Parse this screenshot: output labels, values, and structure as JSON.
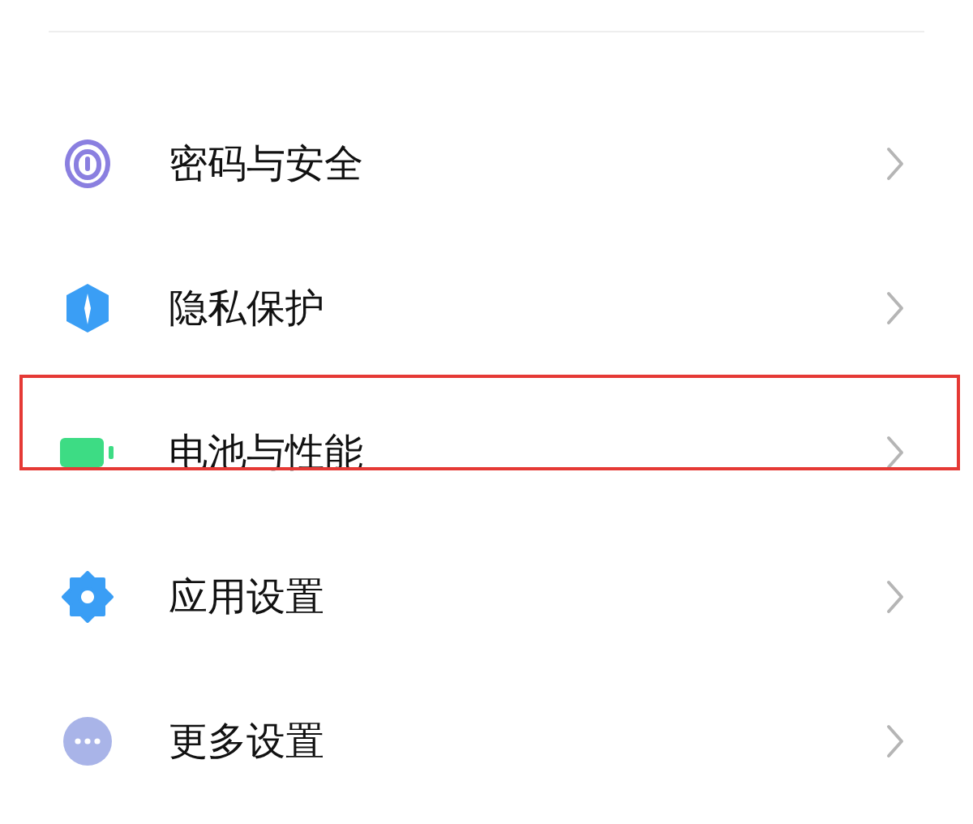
{
  "settings": [
    {
      "kind": "fingerprint",
      "label": "密码与安全",
      "highlighted": false
    },
    {
      "kind": "shield",
      "label": "隐私保护",
      "highlighted": false
    },
    {
      "kind": "battery",
      "label": "电池与性能",
      "highlighted": true
    },
    {
      "kind": "gear",
      "label": "应用设置",
      "highlighted": false
    },
    {
      "kind": "more",
      "label": "更多设置",
      "highlighted": false
    }
  ]
}
